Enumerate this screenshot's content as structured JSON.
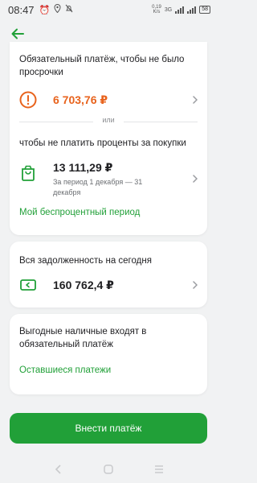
{
  "status_bar": {
    "time": "08:47",
    "speed_value": "0,19",
    "speed_unit": "K/s",
    "network": "3G",
    "battery": "58"
  },
  "card_payment": {
    "mandatory_text": "Обязательный платёж, чтобы не было просрочки",
    "mandatory_amount": "6 703,76 ₽",
    "or_label": "или",
    "interest_text": "чтобы не платить проценты за покупки",
    "interest_amount": "13 111,29 ₽",
    "interest_period": "За период 1 декабря — 31 декабря",
    "grace_link": "Мой беспроцентный период"
  },
  "card_debt": {
    "label": "Вся задолженность на сегодня",
    "amount": "160 762,4 ₽"
  },
  "card_cash": {
    "text": "Выгодные наличные входят в обязательный платёж",
    "link": "Оставшиеся платежи"
  },
  "pay_button": "Внести платёж",
  "colors": {
    "accent_green": "#21a038",
    "warning_orange": "#e8631d"
  }
}
